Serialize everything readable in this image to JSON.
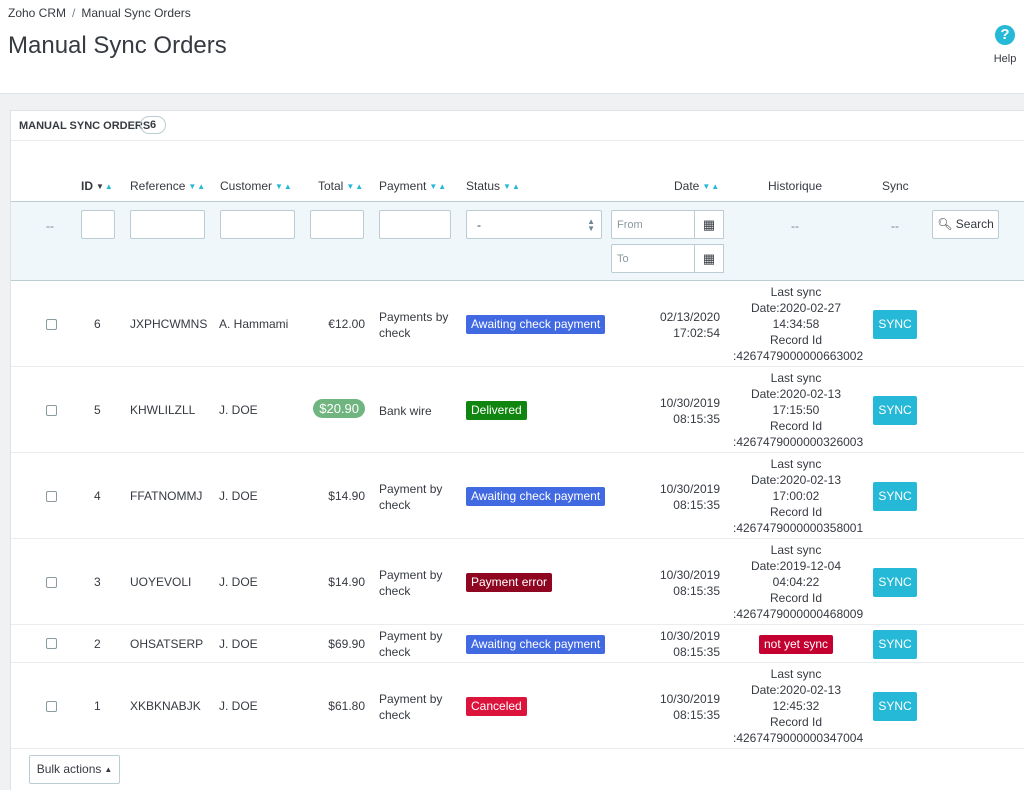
{
  "breadcrumb": {
    "root": "Zoho CRM",
    "separator": "/",
    "current": "Manual Sync Orders"
  },
  "page_title": "Manual Sync Orders",
  "help": {
    "icon": "question-circle-icon",
    "label": "Help"
  },
  "panel": {
    "title": "MANUAL SYNC ORDERS",
    "count": "6"
  },
  "columns": {
    "id": "ID",
    "reference": "Reference",
    "customer": "Customer",
    "total": "Total",
    "payment": "Payment",
    "status": "Status",
    "date": "Date",
    "historique": "Historique",
    "sync": "Sync"
  },
  "filters": {
    "checkbox_placeholder": "--",
    "status_selected": "-",
    "date_from_placeholder": "From",
    "date_to_placeholder": "To",
    "historique_placeholder": "--",
    "sync_placeholder": "--",
    "search_label": "Search"
  },
  "colors": {
    "accent": "#25b9d7",
    "awaiting": "#4169e1",
    "delivered": "#108510",
    "payment_error": "#8f0621",
    "canceled": "#dc143c",
    "not_yet_sync": "#c3002f",
    "total_highlight": "#70b580"
  },
  "rows": [
    {
      "id": "6",
      "reference": "JXPHCWMNS",
      "customer": "A. Hammami",
      "total": "€12.00",
      "total_highlight": false,
      "payment": "Payments by check",
      "status": "Awaiting check payment",
      "status_key": "awaiting",
      "date": "02/13/2020",
      "time": "17:02:54",
      "hist": [
        "Last sync",
        "Date:2020-02-27",
        "14:34:58",
        "Record Id",
        ":4267479000000663002"
      ],
      "sync": "SYNC"
    },
    {
      "id": "5",
      "reference": "KHWLILZLL",
      "customer": "J. DOE",
      "total": "$20.90",
      "total_highlight": true,
      "payment": "Bank wire",
      "status": "Delivered",
      "status_key": "delivered",
      "date": "10/30/2019",
      "time": "08:15:35",
      "hist": [
        "Last sync",
        "Date:2020-02-13",
        "17:15:50",
        "Record Id",
        ":4267479000000326003"
      ],
      "sync": "SYNC"
    },
    {
      "id": "4",
      "reference": "FFATNOMMJ",
      "customer": "J. DOE",
      "total": "$14.90",
      "total_highlight": false,
      "payment": "Payment by check",
      "status": "Awaiting check payment",
      "status_key": "awaiting",
      "date": "10/30/2019",
      "time": "08:15:35",
      "hist": [
        "Last sync",
        "Date:2020-02-13",
        "17:00:02",
        "Record Id",
        ":4267479000000358001"
      ],
      "sync": "SYNC"
    },
    {
      "id": "3",
      "reference": "UOYEVOLI",
      "customer": "J. DOE",
      "total": "$14.90",
      "total_highlight": false,
      "payment": "Payment by check",
      "status": "Payment error",
      "status_key": "payment_error",
      "date": "10/30/2019",
      "time": "08:15:35",
      "hist": [
        "Last sync",
        "Date:2019-12-04",
        "04:04:22",
        "Record Id",
        ":4267479000000468009"
      ],
      "sync": "SYNC"
    },
    {
      "id": "2",
      "reference": "OHSATSERP",
      "customer": "J. DOE",
      "total": "$69.90",
      "total_highlight": false,
      "payment": "Payment by check",
      "status": "Awaiting check payment",
      "status_key": "awaiting",
      "date": "10/30/2019",
      "time": "08:15:35",
      "hist_badge": "not yet sync",
      "sync": "SYNC"
    },
    {
      "id": "1",
      "reference": "XKBKNABJK",
      "customer": "J. DOE",
      "total": "$61.80",
      "total_highlight": false,
      "payment": "Payment by check",
      "status": "Canceled",
      "status_key": "canceled",
      "date": "10/30/2019",
      "time": "08:15:35",
      "hist": [
        "Last sync",
        "Date:2020-02-13",
        "12:45:32",
        "Record Id",
        ":4267479000000347004"
      ],
      "sync": "SYNC"
    }
  ],
  "bulk_actions": "Bulk actions"
}
